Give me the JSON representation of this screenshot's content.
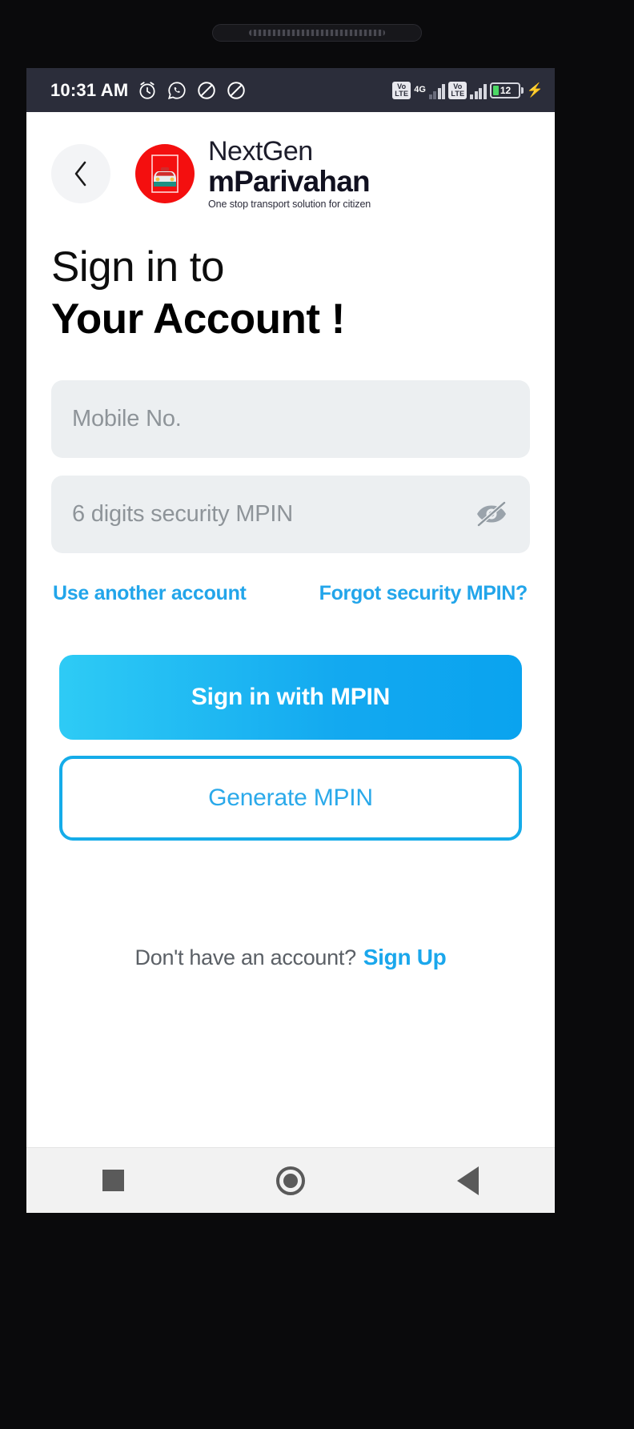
{
  "status_bar": {
    "time": "10:31 AM",
    "icons": [
      "alarm-icon",
      "whatsapp-icon",
      "dnd-icon",
      "dnd-icon"
    ],
    "network_label_1": "Vo\nLTE",
    "volte_top": "Vo",
    "volte_bottom": "LTE",
    "network_type": "4G",
    "battery_percent": "12",
    "charging": true
  },
  "header": {
    "back_icon": "chevron-left-icon",
    "logo_icon": "car-logo-icon",
    "brand_line1": "NextGen",
    "brand_line2": "mParivahan",
    "tagline": "One stop transport solution for citizen"
  },
  "heading": {
    "line1": "Sign in to",
    "line2": "Your Account !"
  },
  "form": {
    "mobile_placeholder": "Mobile No.",
    "mobile_value": "",
    "mpin_placeholder": "6 digits security MPIN",
    "mpin_value": "",
    "toggle_visibility_icon": "eye-off-icon",
    "link_use_another": "Use another account",
    "link_forgot": "Forgot security MPIN?",
    "primary_button": "Sign in with MPIN",
    "secondary_button": "Generate MPIN"
  },
  "footer": {
    "question": "Don't have an account?",
    "action": "Sign Up"
  },
  "nav": {
    "recents": "square-recents-icon",
    "home": "circle-home-icon",
    "back": "triangle-back-icon"
  },
  "colors": {
    "accent_blue": "#15ace9",
    "link_blue": "#22a5ea",
    "brand_red": "#f40f0f",
    "field_bg": "#eceff1",
    "status_bg": "#2b2d3a"
  }
}
